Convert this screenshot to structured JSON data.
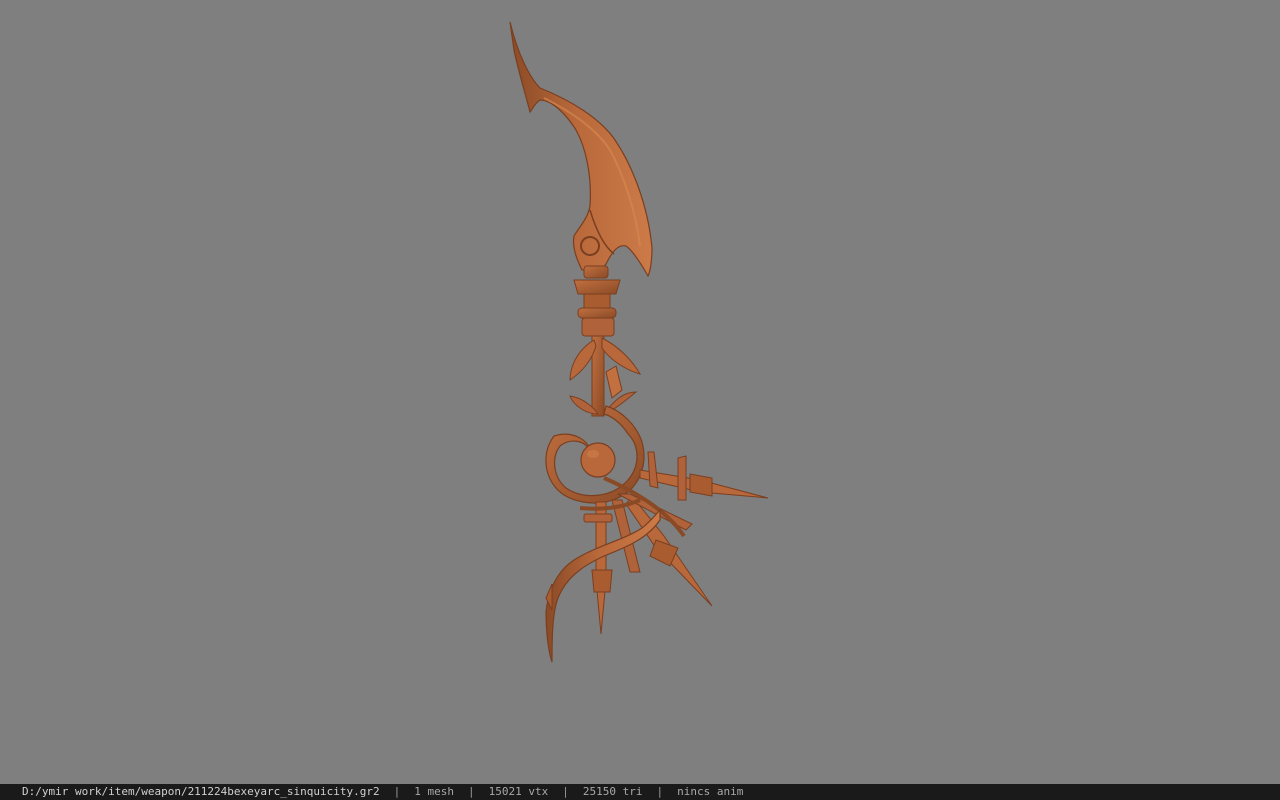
{
  "viewport": {
    "background_color": "#7f7f7f",
    "model_color": "#b8683a",
    "model_shade_color": "#8a4a26",
    "model_highlight_color": "#cc7a48",
    "model_semantic": "sword-weapon-model"
  },
  "statusbar": {
    "file_path": "D:/ymir work/item/weapon/211224bexeyarc_sinquicity.gr2",
    "separator": "|",
    "mesh_count": "1 mesh",
    "vertex_count": "15021 vtx",
    "triangle_count": "25150 tri",
    "anim_status": "nincs anim"
  }
}
